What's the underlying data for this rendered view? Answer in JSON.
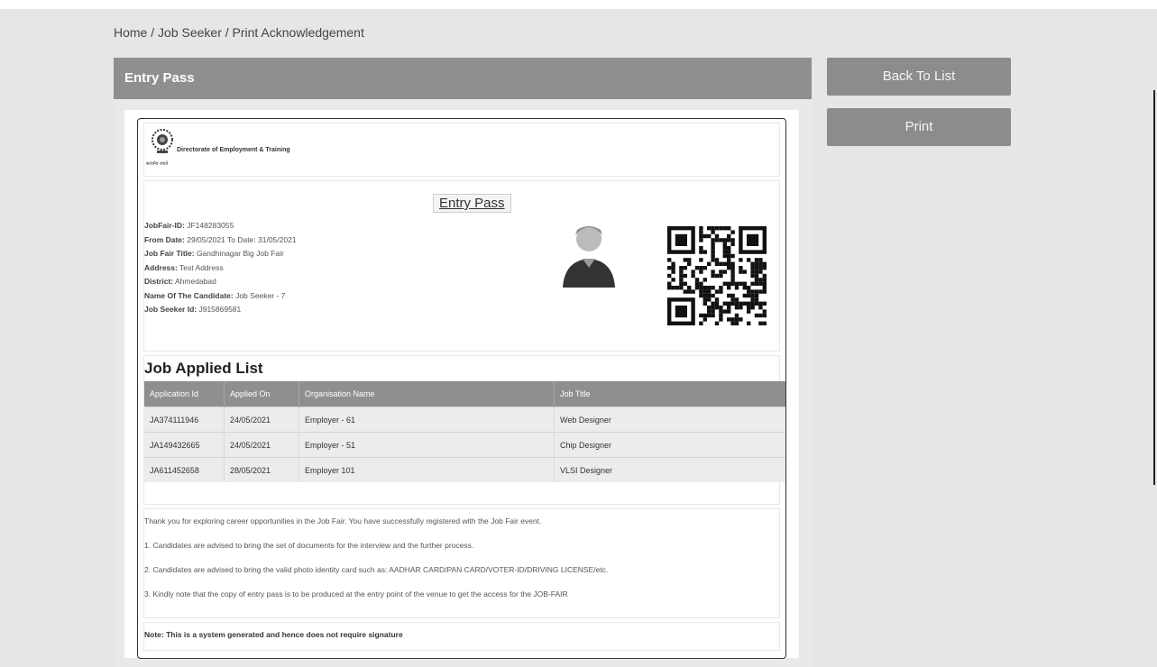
{
  "breadcrumb": {
    "home": "Home",
    "section": "Job Seeker",
    "current": "Print Acknowledgement",
    "sep": "/"
  },
  "panel": {
    "title": "Entry Pass"
  },
  "actions": {
    "back": "Back To List",
    "print": "Print"
  },
  "pass": {
    "org_name": "Directorate of Employment & Training",
    "emblem_caption": "सत्यमेव जयते",
    "title": "Entry Pass",
    "details": [
      {
        "label": "JobFair-ID:",
        "value": " JF148283055"
      },
      {
        "label": "From Date:",
        "value": " 29/05/2021 To Date: 31/05/2021"
      },
      {
        "label": "Job Fair Title:",
        "value": " Gandhinagar Big Job Fair"
      },
      {
        "label": "Address:",
        "value": " Test Address"
      },
      {
        "label": "District:",
        "value": " Ahmedabad"
      },
      {
        "label": "Name Of The Candidate:",
        "value": " Job Seeker - 7"
      },
      {
        "label": "Job Seeker Id:",
        "value": " J915869581"
      }
    ]
  },
  "jobs": {
    "title": "Job Applied List",
    "headers": [
      "Application Id",
      "Applied On",
      "Organisation Name",
      "Job Title"
    ],
    "rows": [
      [
        "JA374111946",
        "24/05/2021",
        "Employer - 61",
        "Web Designer"
      ],
      [
        "JA149432665",
        "24/05/2021",
        "Employer - 51",
        "Chip Designer"
      ],
      [
        "JA611452658",
        "28/05/2021",
        "Employer 101",
        "VLSI Designer"
      ]
    ]
  },
  "notes": [
    "Thank you for exploring career opportunities in the Job Fair. You have successfully registered with the Job Fair event.",
    "1. Candidates are advised to bring the set of documents for the interview and the further process.",
    "2. Candidates are advised to bring the valid photo identity card such as: AADHAR CARD/PAN CARD/VOTER-ID/DRIVING LICENSE/etc.",
    "3. Kindly note that the copy of entry pass is to be produced at the entry point of the venue to get the access for the JOB-FAIR"
  ],
  "signature_note": "Note: This is a system generated and hence does not require signature"
}
